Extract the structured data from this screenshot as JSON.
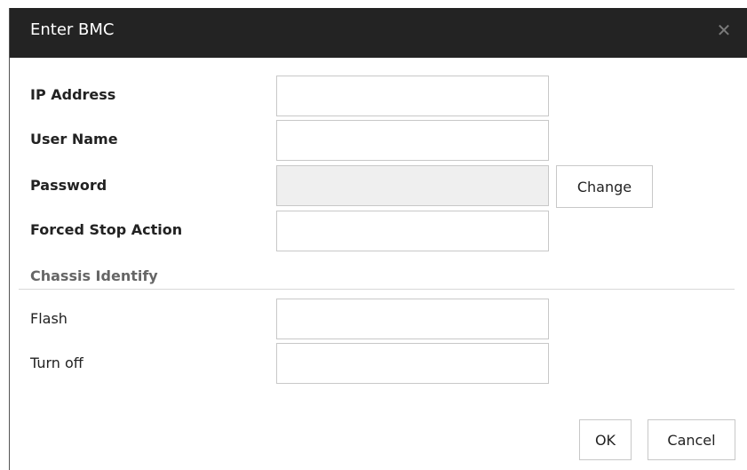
{
  "dialog": {
    "title": "Enter BMC",
    "close_icon": "close-icon"
  },
  "form": {
    "ip_address_label": "IP Address",
    "ip_address_value": "",
    "user_name_label": "User Name",
    "user_name_value": "",
    "password_label": "Password",
    "password_value": "",
    "change_label": "Change",
    "forced_stop_label": "Forced Stop Action",
    "forced_stop_value": "",
    "chassis_section": "Chassis Identify",
    "flash_label": "Flash",
    "flash_value": "",
    "turn_off_label": "Turn off",
    "turn_off_value": ""
  },
  "footer": {
    "ok_label": "OK",
    "cancel_label": "Cancel"
  }
}
